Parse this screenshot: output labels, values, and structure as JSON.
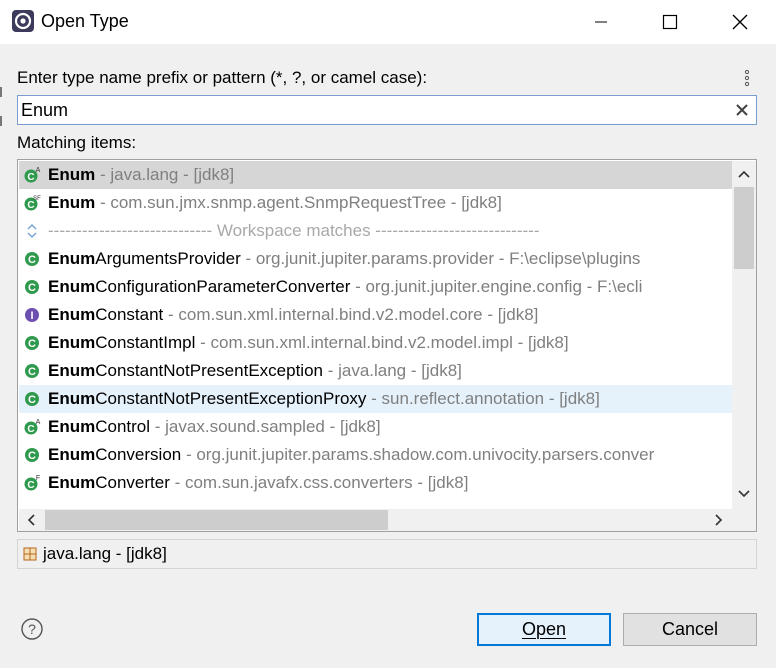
{
  "window": {
    "title": "Open Type"
  },
  "prompt": {
    "label": "Enter type name prefix or pattern (*, ?, or camel case):"
  },
  "search": {
    "value": "Enum"
  },
  "matching": {
    "label": "Matching items:"
  },
  "rows": [
    {
      "bold": "Enum",
      "rest": "",
      "qual": " - java.lang - [jdk8]",
      "icon": "class-abstract-icon",
      "state": "selected"
    },
    {
      "bold": "Enum",
      "rest": "",
      "qual": " - com.sun.jmx.snmp.agent.SnmpRequestTree - [jdk8]",
      "icon": "class-static-final-icon",
      "state": ""
    },
    {
      "separator": "----------------------------- Workspace matches -----------------------------",
      "icon": "separator-icon"
    },
    {
      "bold": "Enum",
      "rest": "ArgumentsProvider",
      "qual": " - org.junit.jupiter.params.provider - F:\\eclipse\\plugins",
      "icon": "class-icon",
      "state": ""
    },
    {
      "bold": "Enum",
      "rest": "ConfigurationParameterConverter",
      "qual": " - org.junit.jupiter.engine.config - F:\\ecli",
      "icon": "class-icon",
      "state": ""
    },
    {
      "bold": "Enum",
      "rest": "Constant",
      "qual": " - com.sun.xml.internal.bind.v2.model.core - [jdk8]",
      "icon": "interface-icon",
      "state": ""
    },
    {
      "bold": "Enum",
      "rest": "ConstantImpl",
      "qual": " - com.sun.xml.internal.bind.v2.model.impl - [jdk8]",
      "icon": "class-icon",
      "state": ""
    },
    {
      "bold": "Enum",
      "rest": "ConstantNotPresentException",
      "qual": " - java.lang - [jdk8]",
      "icon": "class-icon",
      "state": ""
    },
    {
      "bold": "Enum",
      "rest": "ConstantNotPresentExceptionProxy",
      "qual": " - sun.reflect.annotation - [jdk8]",
      "icon": "class-icon",
      "state": "hover"
    },
    {
      "bold": "Enum",
      "rest": "Control",
      "qual": " - javax.sound.sampled - [jdk8]",
      "icon": "class-abstract-icon",
      "state": ""
    },
    {
      "bold": "Enum",
      "rest": "Conversion",
      "qual": " - org.junit.jupiter.params.shadow.com.univocity.parsers.conver",
      "icon": "class-icon",
      "state": ""
    },
    {
      "bold": "Enum",
      "rest": "Converter",
      "qual": " - com.sun.javafx.css.converters - [jdk8]",
      "icon": "class-final-icon",
      "state": ""
    }
  ],
  "status": {
    "text": "java.lang - [jdk8]",
    "icon": "package-icon"
  },
  "buttons": {
    "open": "Open",
    "cancel": "Cancel"
  },
  "colors": {
    "accent": "#0078d7",
    "class_icon": "#2f9a4d",
    "interface_icon": "#6c4fae",
    "selected_row": "#d6d6d6",
    "hover_row": "#e5f1fb"
  }
}
